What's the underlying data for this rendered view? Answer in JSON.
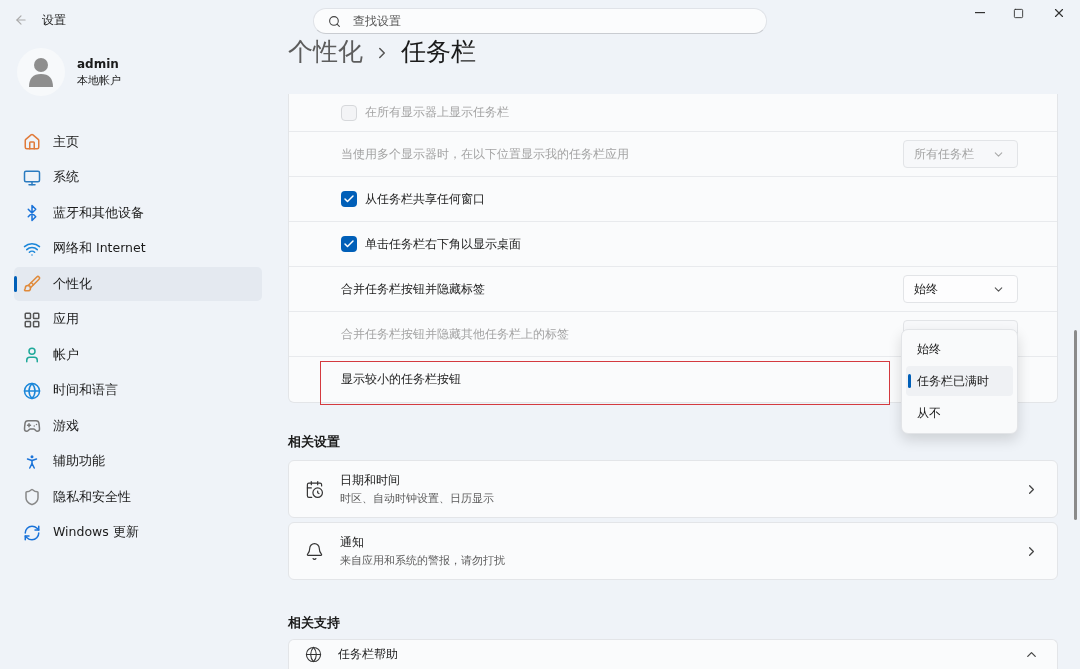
{
  "window": {
    "title": "设置"
  },
  "search": {
    "placeholder": "查找设置"
  },
  "account": {
    "name": "admin",
    "type": "本地帐户"
  },
  "nav": [
    {
      "label": "主页",
      "selected": false
    },
    {
      "label": "系统",
      "selected": false
    },
    {
      "label": "蓝牙和其他设备",
      "selected": false
    },
    {
      "label": "网络和 Internet",
      "selected": false
    },
    {
      "label": "个性化",
      "selected": true
    },
    {
      "label": "应用",
      "selected": false
    },
    {
      "label": "帐户",
      "selected": false
    },
    {
      "label": "时间和语言",
      "selected": false
    },
    {
      "label": "游戏",
      "selected": false
    },
    {
      "label": "辅助功能",
      "selected": false
    },
    {
      "label": "隐私和安全性",
      "selected": false
    },
    {
      "label": "Windows 更新",
      "selected": false
    }
  ],
  "breadcrumb": [
    "个性化",
    "任务栏"
  ],
  "settings": [
    {
      "kind": "checkbox",
      "label": "在所有显示器上显示任务栏",
      "checked": false,
      "disabled": true
    },
    {
      "kind": "dropdown",
      "label": "当使用多个显示器时，在以下位置显示我的任务栏应用",
      "value": "所有任务栏",
      "disabled": true
    },
    {
      "kind": "checkbox",
      "label": "从任务栏共享任何窗口",
      "checked": true,
      "disabled": false
    },
    {
      "kind": "checkbox",
      "label": "单击任务栏右下角以显示桌面",
      "checked": true,
      "disabled": false
    },
    {
      "kind": "dropdown",
      "label": "合并任务栏按钮并隐藏标签",
      "value": "始终",
      "disabled": false
    },
    {
      "kind": "dropdown",
      "label": "合并任务栏按钮并隐藏其他任务栏上的标签",
      "disabled": true
    },
    {
      "kind": "plain",
      "label": "显示较小的任务栏按钮",
      "highlighted": true
    }
  ],
  "menu": {
    "options": [
      {
        "label": "始终",
        "selected": false
      },
      {
        "label": "任务栏已满时",
        "selected": true
      },
      {
        "label": "从不",
        "selected": false
      }
    ]
  },
  "related_settings": {
    "heading": "相关设置",
    "items": [
      {
        "title": "日期和时间",
        "subtitle": "时区、自动时钟设置、日历显示"
      },
      {
        "title": "通知",
        "subtitle": "来自应用和系统的警报，请勿打扰"
      }
    ]
  },
  "related_support": {
    "heading": "相关支持",
    "items": [
      {
        "title": "任务栏帮助",
        "expanded": true
      }
    ]
  }
}
